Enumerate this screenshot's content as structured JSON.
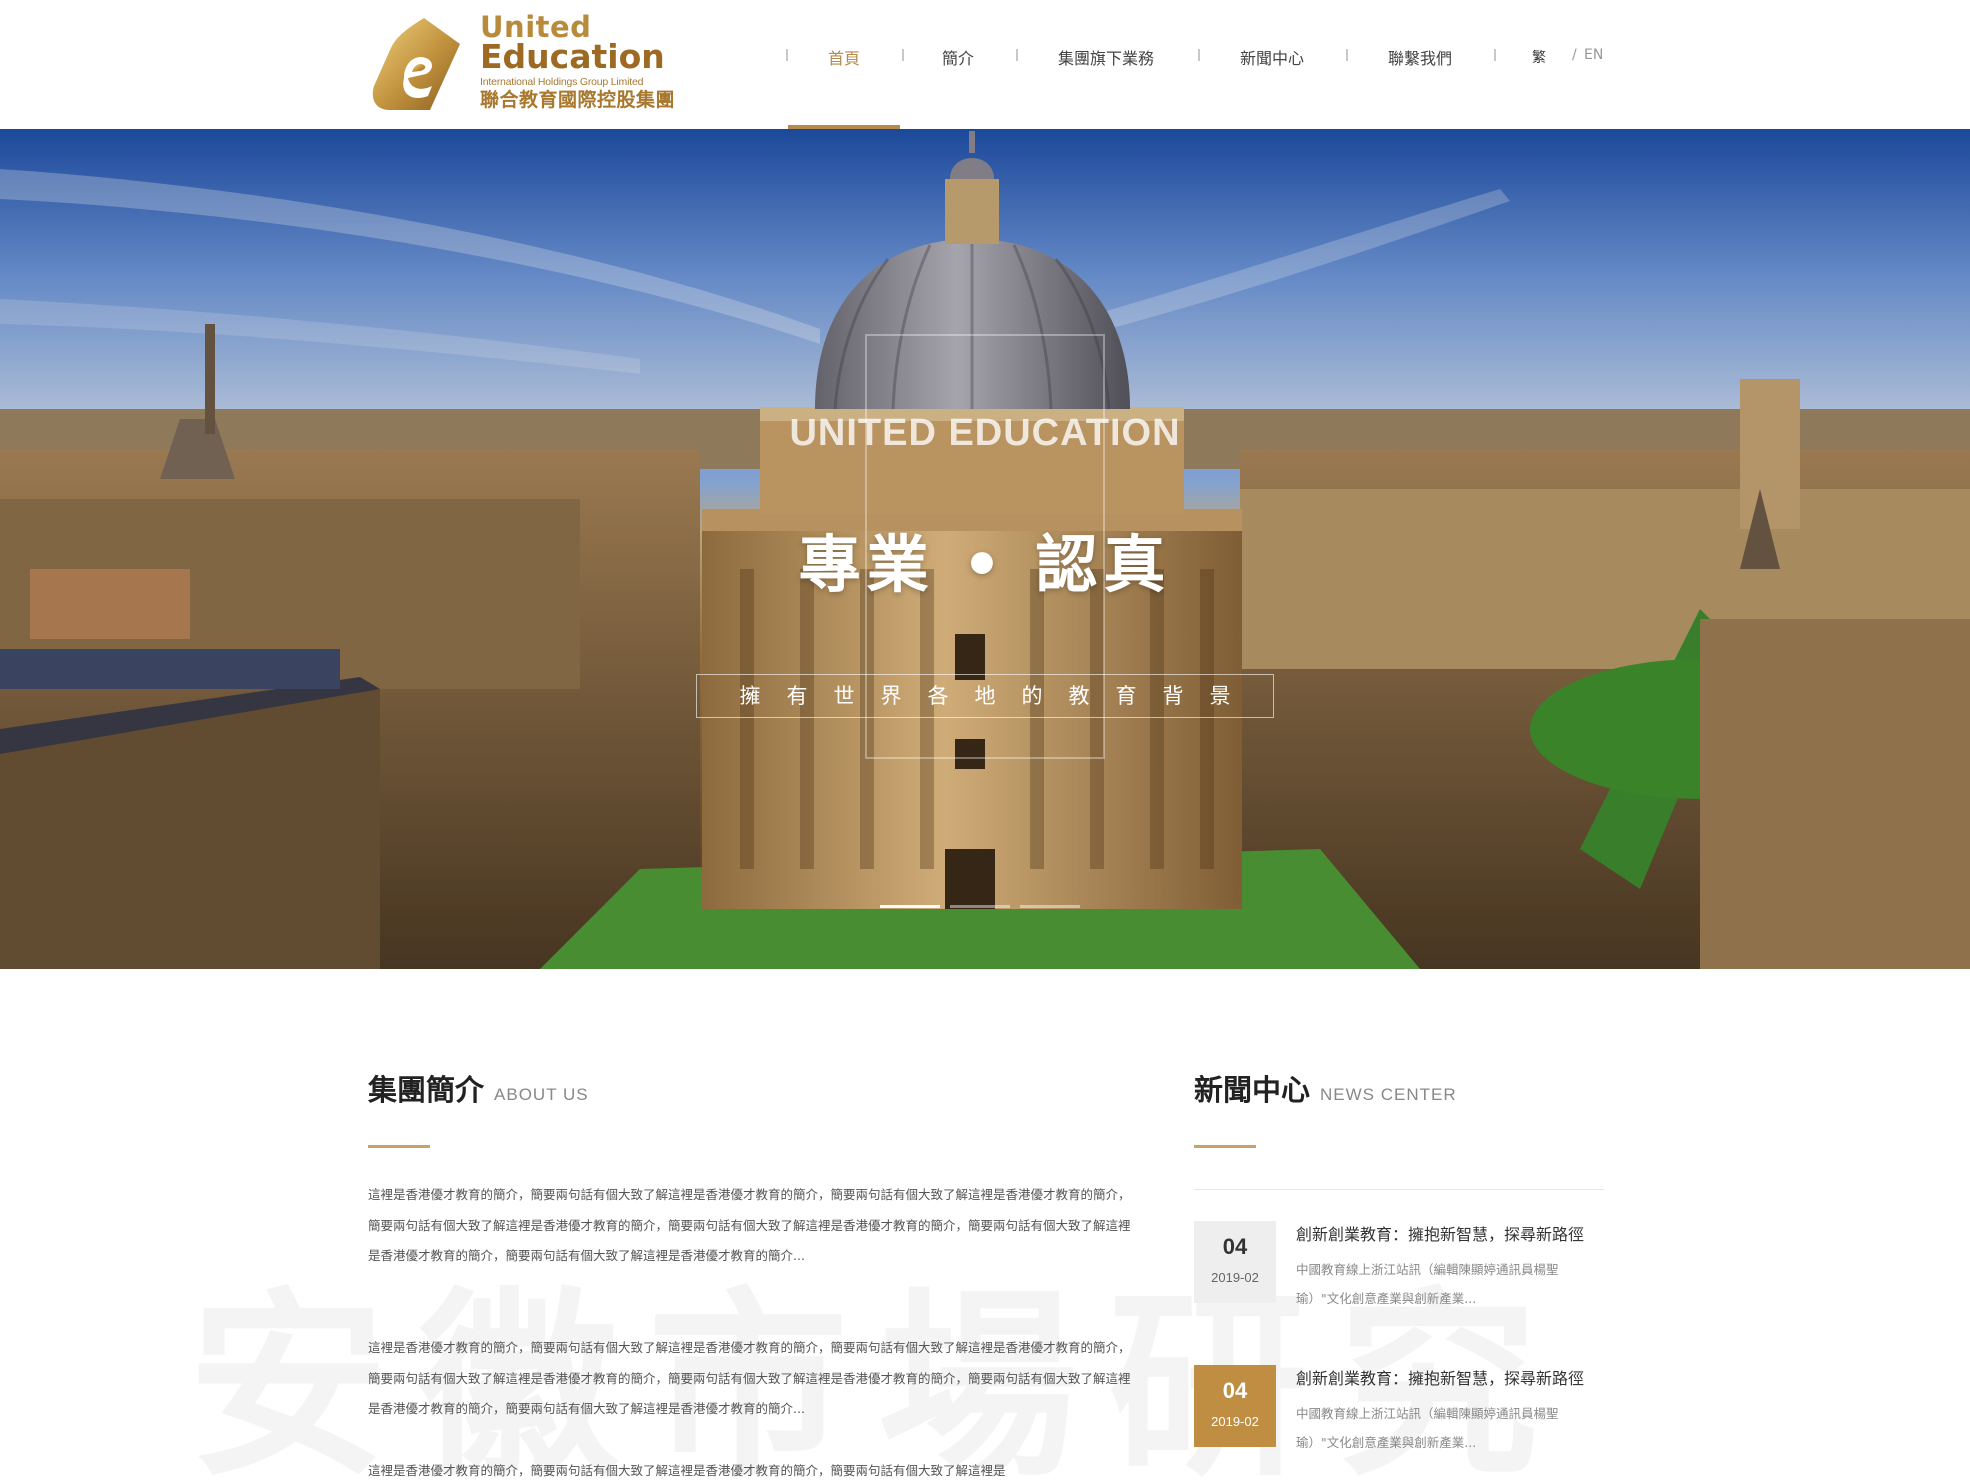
{
  "logo": {
    "line1": "United",
    "line2": "Education",
    "line3": "International Holdings Group Limited",
    "line4": "聯合教育國際控股集團",
    "gold": "#b78a3c"
  },
  "nav": {
    "items": [
      {
        "label": "首頁",
        "active": true
      },
      {
        "label": "簡介",
        "active": false
      },
      {
        "label": "集團旗下業務",
        "active": false
      },
      {
        "label": "新聞中心",
        "active": false
      },
      {
        "label": "聯繫我們",
        "active": false
      }
    ],
    "lang_tc": "繁",
    "lang_sep": "/",
    "lang_en": "EN",
    "accent": "#b68a4a"
  },
  "hero": {
    "title_en": "UNITED EDUCATION",
    "title_cn": "專業 • 認真",
    "subtitle": "擁有世界各地的教育背景",
    "slide_count": 3,
    "active_slide": 1
  },
  "about": {
    "title": "集團簡介",
    "title_en": "ABOUT US",
    "paragraphs": [
      "這裡是香港優才教育的簡介，簡要兩句話有個大致了解這裡是香港優才教育的簡介，簡要兩句話有個大致了解這裡是香港優才教育的簡介，簡要兩句話有個大致了解這裡是香港優才教育的簡介，簡要兩句話有個大致了解這裡是香港優才教育的簡介，簡要兩句話有個大致了解這裡是香港優才教育的簡介，簡要兩句話有個大致了解這裡是香港優才教育的簡介...",
      "這裡是香港優才教育的簡介，簡要兩句話有個大致了解這裡是香港優才教育的簡介，簡要兩句話有個大致了解這裡是香港優才教育的簡介，簡要兩句話有個大致了解這裡是香港優才教育的簡介，簡要兩句話有個大致了解這裡是香港優才教育的簡介，簡要兩句話有個大致了解這裡是香港優才教育的簡介，簡要兩句話有個大致了解這裡是香港優才教育的簡介...",
      "這裡是香港優才教育的簡介，簡要兩句話有個大致了解這裡是香港優才教育的簡介，簡要兩句話有個大致了解這裡是"
    ]
  },
  "news": {
    "title": "新聞中心",
    "title_en": "NEWS CENTER",
    "items": [
      {
        "day": "04",
        "ym": "2019-02",
        "title": "創新創業教育：擁抱新智慧，探尋新路徑",
        "excerpt": "中國教育線上浙江站訊（編輯陳顯婷通訊員楊聖瑜）\"文化創意產業與創新產業...",
        "active": false
      },
      {
        "day": "04",
        "ym": "2019-02",
        "title": "創新創業教育：擁抱新智慧，探尋新路徑",
        "excerpt": "中國教育線上浙江站訊（編輯陳顯婷通訊員楊聖瑜）\"文化創意產業與創新產業...",
        "active": true
      }
    ]
  },
  "watermark": "安徽市場研究"
}
